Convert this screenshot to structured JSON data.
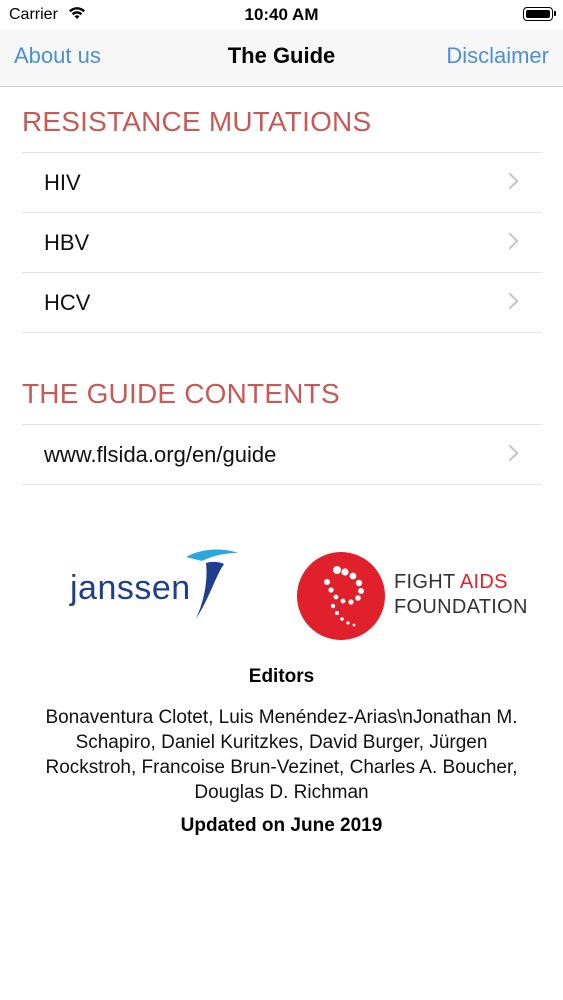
{
  "status_bar": {
    "carrier": "Carrier",
    "time": "10:40 AM",
    "battery_level": 1.0
  },
  "nav": {
    "left": "About us",
    "title": "The Guide",
    "right": "Disclaimer"
  },
  "sections": [
    {
      "title": "RESISTANCE MUTATIONS",
      "rows": [
        "HIV",
        "HBV",
        "HCV"
      ]
    },
    {
      "title": "THE GUIDE CONTENTS",
      "rows": [
        "www.flsida.org/en/guide"
      ]
    }
  ],
  "logos": {
    "janssen": "janssen",
    "faf_line1_a": "FIGHT ",
    "faf_line1_b": "AIDS",
    "faf_line2": "FOUNDATION"
  },
  "editors": {
    "title": "Editors",
    "names": "Bonaventura Clotet, Luis Menéndez-Arias\\nJonathan M. Schapiro, Daniel Kuritzkes, David Burger, Jürgen Rockstroh, Francoise Brun-Vezinet, Charles A. Boucher, Douglas D. Richman"
  },
  "updated": "Updated on June 2019",
  "colors": {
    "accent": "#4a90d9",
    "section": "#c75a57",
    "janssen": "#1f3f8e",
    "faf_red": "#e0202a"
  }
}
